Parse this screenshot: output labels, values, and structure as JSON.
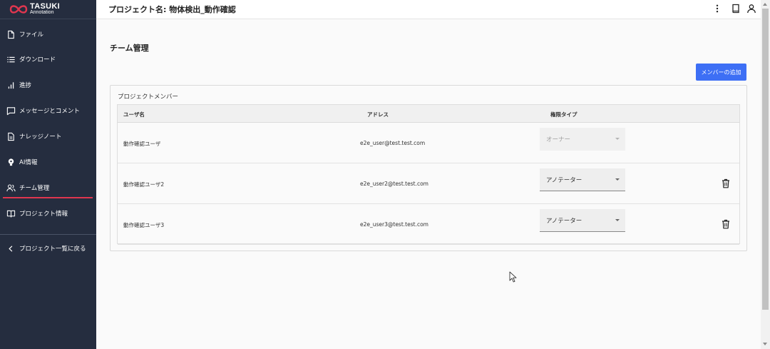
{
  "brand": {
    "name": "TASUKI",
    "subtitle": "Annotation",
    "color": "#e0364f"
  },
  "header": {
    "project_title": "プロジェクト名: 物体検出_動作確認"
  },
  "sidebar": {
    "items": [
      {
        "label": "ファイル",
        "icon": "file-icon"
      },
      {
        "label": "ダウンロード",
        "icon": "list-icon"
      },
      {
        "label": "進捗",
        "icon": "bar-chart-icon"
      },
      {
        "label": "メッセージとコメント",
        "icon": "chat-icon"
      },
      {
        "label": "ナレッジノート",
        "icon": "document-icon"
      },
      {
        "label": "AI情報",
        "icon": "bulb-icon"
      },
      {
        "label": "チーム管理",
        "icon": "people-icon",
        "active": true
      },
      {
        "label": "プロジェクト情報",
        "icon": "book-icon"
      }
    ],
    "back_label": "プロジェクト一覧に戻る"
  },
  "main": {
    "heading": "チーム管理",
    "add_member_label": "メンバーの追加",
    "card_title": "プロジェクトメンバー",
    "columns": {
      "user": "ユーザ名",
      "address": "アドレス",
      "role": "権限タイプ"
    },
    "members": [
      {
        "name": "動作確認ユーザ",
        "email": "e2e_user@test.test.com",
        "role": "オーナー",
        "editable": false
      },
      {
        "name": "動作確認ユーザ2",
        "email": "e2e_user2@test.test.com",
        "role": "アノテーター",
        "editable": true
      },
      {
        "name": "動作確認ユーザ3",
        "email": "e2e_user3@test.test.com",
        "role": "アノテーター",
        "editable": true
      }
    ]
  },
  "colors": {
    "sidebar_bg": "#252d3f",
    "accent_button": "#3d6ff5",
    "active_indicator": "#e0364f"
  }
}
